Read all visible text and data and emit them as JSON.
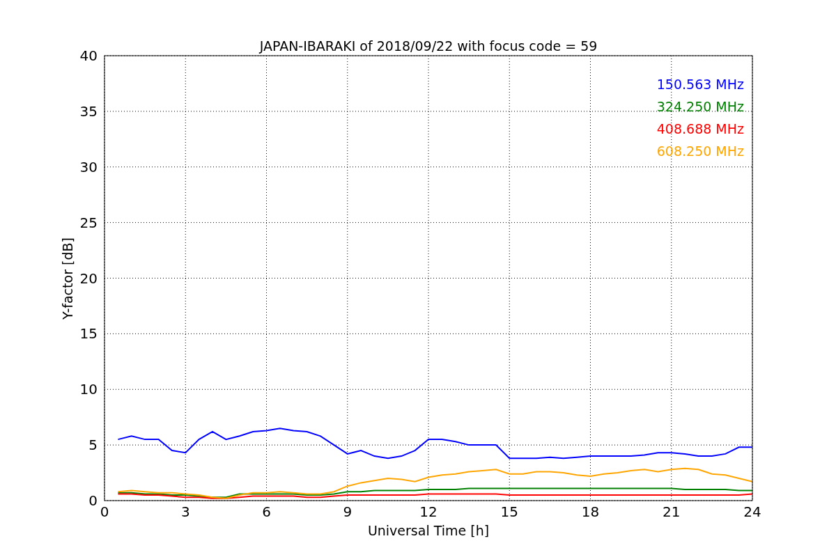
{
  "chart_data": {
    "type": "line",
    "title": "JAPAN-IBARAKI of 2018/09/22 with focus code = 59",
    "xlabel": "Universal Time [h]",
    "ylabel": "Y-factor [dB]",
    "x": [
      0.5,
      1,
      1.5,
      2,
      2.5,
      3,
      3.5,
      4,
      4.5,
      5,
      5.5,
      6,
      6.5,
      7,
      7.5,
      8,
      8.5,
      9,
      9.5,
      10,
      10.5,
      11,
      11.5,
      12,
      12.5,
      13,
      13.5,
      14,
      14.5,
      15,
      15.5,
      16,
      16.5,
      17,
      17.5,
      18,
      18.5,
      19,
      19.5,
      20,
      20.5,
      21,
      21.5,
      22,
      22.5,
      23,
      23.5,
      24
    ],
    "series": [
      {
        "name": "150.563 MHz",
        "color": "#0000ff",
        "values": [
          5.5,
          5.8,
          5.5,
          5.5,
          4.5,
          4.3,
          5.5,
          6.2,
          5.5,
          5.8,
          6.2,
          6.3,
          6.5,
          6.3,
          6.2,
          5.8,
          5,
          4.2,
          4.5,
          4,
          3.8,
          4,
          4.5,
          5.5,
          5.5,
          5.3,
          5,
          5,
          5,
          3.8,
          3.8,
          3.8,
          3.9,
          3.8,
          3.9,
          4,
          4,
          4,
          4,
          4.1,
          4.3,
          4.3,
          4.2,
          4,
          4,
          4.2,
          4.8,
          4.8
        ]
      },
      {
        "name": "324.250 MHz",
        "color": "#008000",
        "values": [
          0.7,
          0.7,
          0.6,
          0.6,
          0.5,
          0.5,
          0.4,
          0.3,
          0.3,
          0.6,
          0.6,
          0.6,
          0.6,
          0.6,
          0.5,
          0.5,
          0.6,
          0.8,
          0.8,
          0.9,
          0.9,
          0.9,
          0.9,
          1,
          1,
          1,
          1.1,
          1.1,
          1.1,
          1.1,
          1.1,
          1.1,
          1.1,
          1.1,
          1.1,
          1.1,
          1.1,
          1.1,
          1.1,
          1.1,
          1.1,
          1.1,
          1,
          1,
          1,
          1,
          0.9,
          0.9
        ]
      },
      {
        "name": "408.688 MHz",
        "color": "#ff0000",
        "values": [
          0.6,
          0.6,
          0.5,
          0.5,
          0.4,
          0.3,
          0.3,
          0.2,
          0.2,
          0.3,
          0.4,
          0.4,
          0.4,
          0.4,
          0.3,
          0.3,
          0.4,
          0.5,
          0.5,
          0.5,
          0.5,
          0.5,
          0.5,
          0.6,
          0.6,
          0.6,
          0.6,
          0.6,
          0.6,
          0.5,
          0.5,
          0.5,
          0.5,
          0.5,
          0.5,
          0.5,
          0.5,
          0.5,
          0.5,
          0.5,
          0.5,
          0.5,
          0.5,
          0.5,
          0.5,
          0.5,
          0.5,
          0.6
        ]
      },
      {
        "name": "608.250 MHz",
        "color": "#ffa500",
        "values": [
          0.8,
          0.9,
          0.8,
          0.7,
          0.7,
          0.6,
          0.5,
          0.3,
          0.2,
          0.5,
          0.7,
          0.7,
          0.8,
          0.7,
          0.6,
          0.6,
          0.8,
          1.3,
          1.6,
          1.8,
          2,
          1.9,
          1.7,
          2.1,
          2.3,
          2.4,
          2.6,
          2.7,
          2.8,
          2.4,
          2.4,
          2.6,
          2.6,
          2.5,
          2.3,
          2.2,
          2.4,
          2.5,
          2.7,
          2.8,
          2.6,
          2.8,
          2.9,
          2.8,
          2.4,
          2.3,
          2,
          1.7
        ]
      }
    ],
    "xlim": [
      0,
      24
    ],
    "ylim": [
      0,
      40
    ],
    "xticks": [
      0,
      3,
      6,
      9,
      12,
      15,
      18,
      21,
      24
    ],
    "yticks": [
      0,
      5,
      10,
      15,
      20,
      25,
      30,
      35,
      40
    ],
    "grid": true
  }
}
